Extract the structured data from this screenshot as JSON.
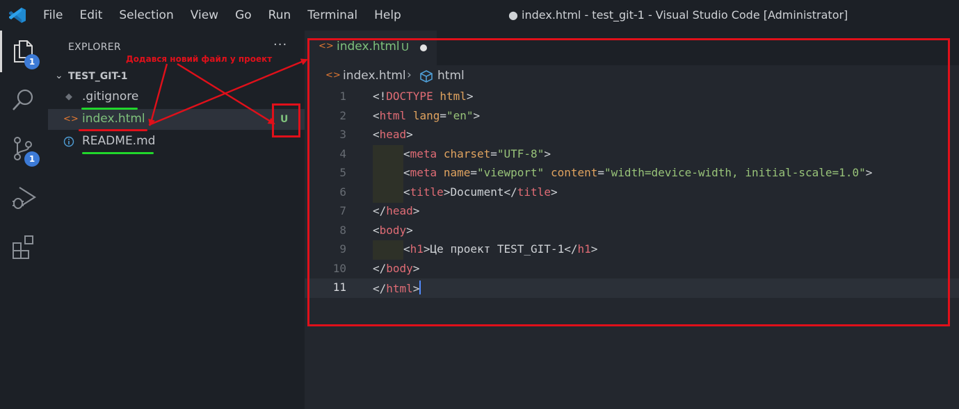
{
  "menu": {
    "items": [
      "File",
      "Edit",
      "Selection",
      "View",
      "Go",
      "Run",
      "Terminal",
      "Help"
    ],
    "window_title": "● index.html - test_git-1 - Visual Studio Code [Administrator]"
  },
  "activity_bar": {
    "items": [
      {
        "icon": "files-icon",
        "badge": "1"
      },
      {
        "icon": "search-icon"
      },
      {
        "icon": "source-control-icon",
        "badge": "1"
      },
      {
        "icon": "run-debug-icon"
      },
      {
        "icon": "extensions-icon"
      }
    ]
  },
  "sidebar": {
    "title": "EXPLORER",
    "more": "···",
    "folder": "TEST_GIT-1",
    "files": [
      {
        "name": ".gitignore",
        "icon": "git-file-icon",
        "color": "#c2c5ca"
      },
      {
        "name": "index.html",
        "icon": "html-file-icon",
        "color": "#7fc17c",
        "status": "U"
      },
      {
        "name": "README.md",
        "icon": "info-file-icon",
        "color": "#c2c5ca"
      }
    ]
  },
  "annotation": {
    "text": "Додався новий файл у проект"
  },
  "editor": {
    "tab": {
      "name": "index.html",
      "status": "U"
    },
    "breadcrumb": {
      "file": "index.html",
      "symbol": "html"
    },
    "line_numbers": [
      "1",
      "2",
      "3",
      "4",
      "5",
      "6",
      "7",
      "8",
      "9",
      "10",
      "11"
    ],
    "current_line": "11"
  },
  "colors": {
    "annotation_red": "#e0101a",
    "untracked_green": "#7fc17c",
    "html_icon_orange": "#e37933"
  }
}
